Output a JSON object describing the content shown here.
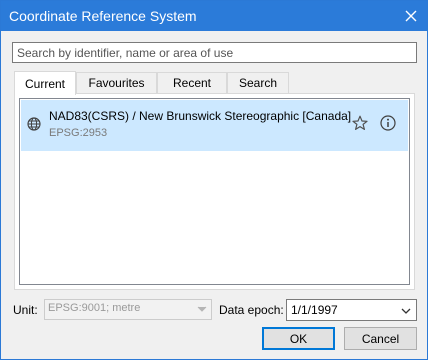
{
  "window": {
    "title": "Coordinate Reference System"
  },
  "search": {
    "placeholder": "Search by identifier, name or area of use",
    "value": ""
  },
  "tabs": [
    {
      "label": "Current",
      "active": true
    },
    {
      "label": "Favourites",
      "active": false
    },
    {
      "label": "Recent",
      "active": false
    },
    {
      "label": "Search",
      "active": false
    }
  ],
  "list": {
    "items": [
      {
        "name": "NAD83(CSRS) / New Brunswick Stereographic [Canada]",
        "code": "EPSG:2953",
        "icon": "globe-icon",
        "selected": true
      }
    ]
  },
  "unit": {
    "label": "Unit:",
    "value": "EPSG:9001; metre",
    "enabled": false
  },
  "epoch": {
    "label": "Data epoch:",
    "value": "1/1/1997"
  },
  "buttons": {
    "ok": "OK",
    "cancel": "Cancel"
  },
  "colors": {
    "titlebar": "#2b7bd9",
    "selection": "#cce8ff",
    "default_button_border": "#0078d7"
  }
}
